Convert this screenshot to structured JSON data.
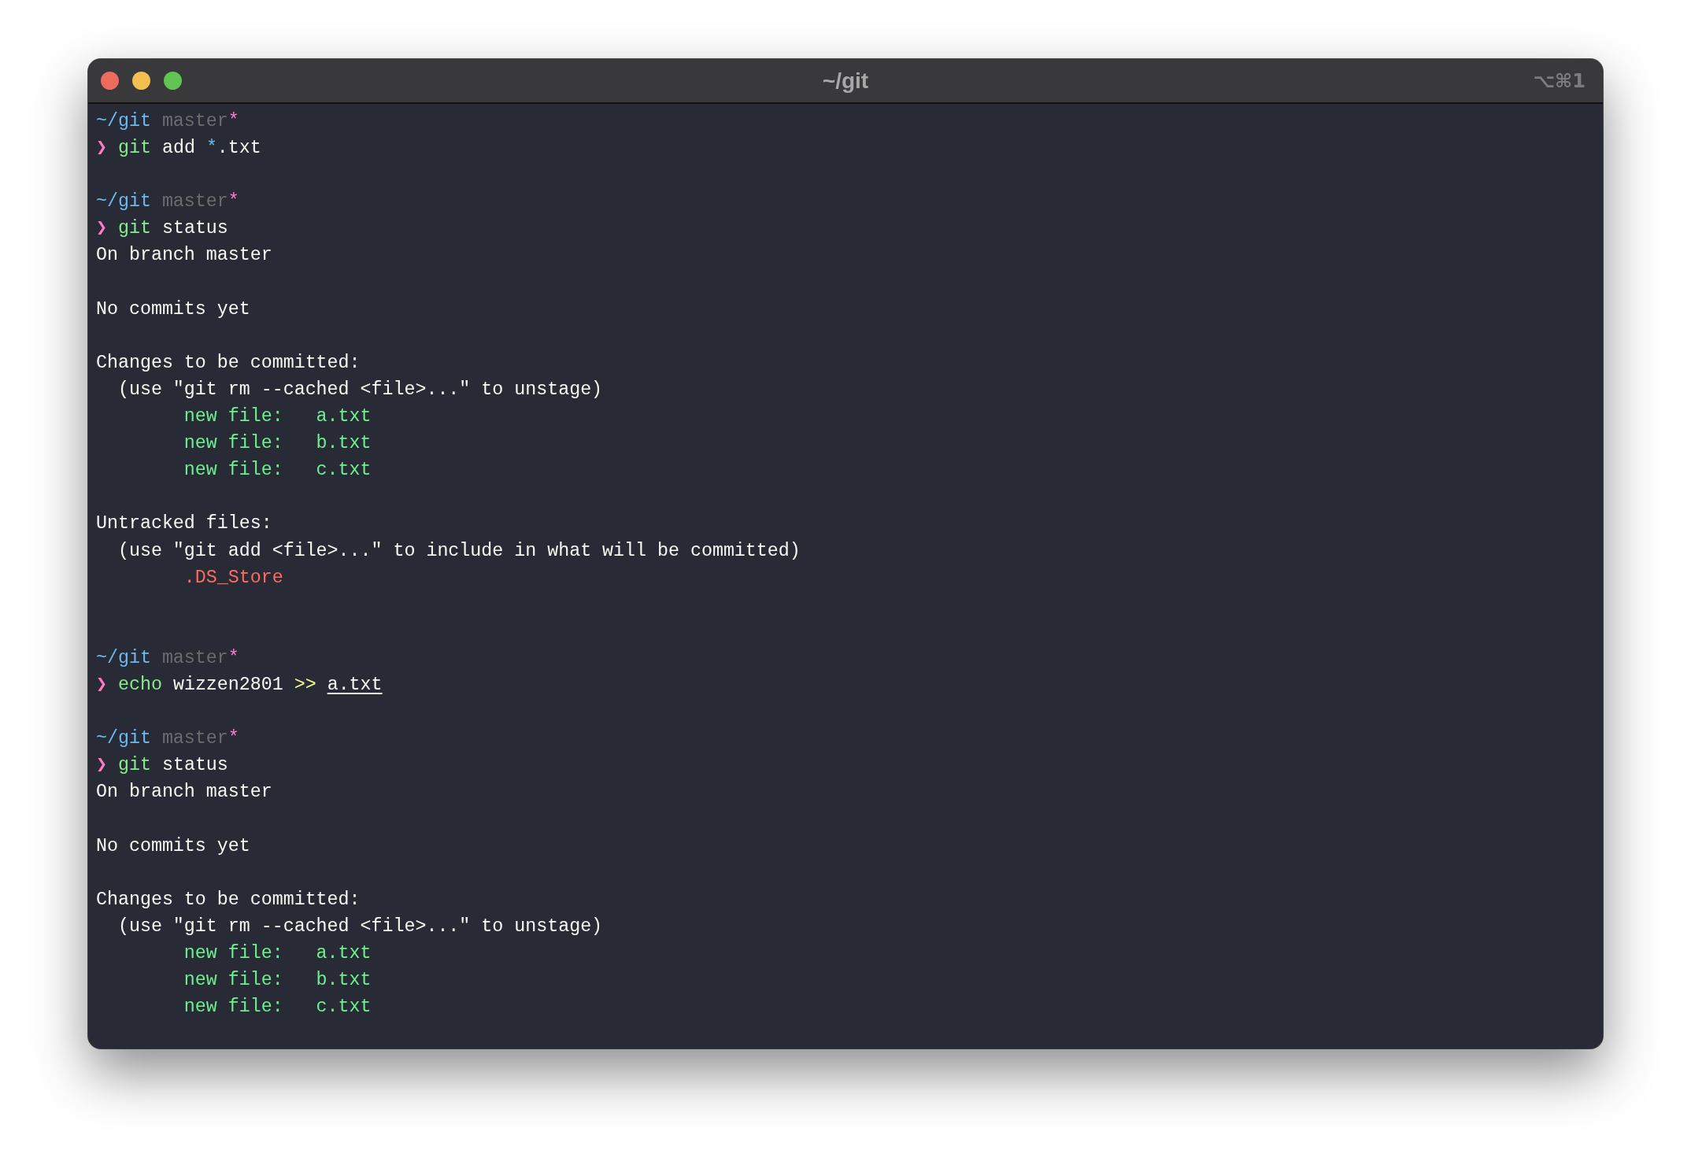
{
  "window": {
    "title": "~/git",
    "shortcut": "⌥⌘1",
    "buttons": [
      {
        "kind": "close"
      },
      {
        "kind": "minimize"
      },
      {
        "kind": "zoom"
      }
    ]
  },
  "lines": [
    {
      "kind": "text",
      "segments": [
        {
          "kind": "path",
          "text": "~/git"
        },
        {
          "kind": "branch",
          "text": " master"
        },
        {
          "kind": "dirty",
          "text": "*"
        }
      ]
    },
    {
      "kind": "text",
      "segments": [
        {
          "kind": "prompt",
          "text": "❯ "
        },
        {
          "kind": "command",
          "text": "git"
        },
        {
          "kind": "plain",
          "text": " add "
        },
        {
          "kind": "glob",
          "text": "*"
        },
        {
          "kind": "plain",
          "text": ".txt"
        }
      ]
    },
    {
      "kind": "blank"
    },
    {
      "kind": "text",
      "segments": [
        {
          "kind": "path",
          "text": "~/git"
        },
        {
          "kind": "branch",
          "text": " master"
        },
        {
          "kind": "dirty",
          "text": "*"
        }
      ]
    },
    {
      "kind": "text",
      "segments": [
        {
          "kind": "prompt",
          "text": "❯ "
        },
        {
          "kind": "command",
          "text": "git"
        },
        {
          "kind": "plain",
          "text": " status"
        }
      ]
    },
    {
      "kind": "text",
      "segments": [
        {
          "kind": "plain",
          "text": "On branch master"
        }
      ]
    },
    {
      "kind": "blank"
    },
    {
      "kind": "text",
      "segments": [
        {
          "kind": "plain",
          "text": "No commits yet"
        }
      ]
    },
    {
      "kind": "blank"
    },
    {
      "kind": "text",
      "segments": [
        {
          "kind": "plain",
          "text": "Changes to be committed:"
        }
      ]
    },
    {
      "kind": "text",
      "segments": [
        {
          "kind": "plain",
          "text": "  (use \"git rm --cached <file>...\" to unstage)"
        }
      ]
    },
    {
      "kind": "indented",
      "segments": [
        {
          "kind": "staged",
          "text": "new file:   a.txt"
        }
      ]
    },
    {
      "kind": "indented",
      "segments": [
        {
          "kind": "staged",
          "text": "new file:   b.txt"
        }
      ]
    },
    {
      "kind": "indented",
      "segments": [
        {
          "kind": "staged",
          "text": "new file:   c.txt"
        }
      ]
    },
    {
      "kind": "blank"
    },
    {
      "kind": "text",
      "segments": [
        {
          "kind": "plain",
          "text": "Untracked files:"
        }
      ]
    },
    {
      "kind": "text",
      "segments": [
        {
          "kind": "plain",
          "text": "  (use \"git add <file>...\" to include in what will be committed)"
        }
      ]
    },
    {
      "kind": "indented",
      "segments": [
        {
          "kind": "untracked",
          "text": ".DS_Store"
        }
      ]
    },
    {
      "kind": "blank"
    },
    {
      "kind": "blank"
    },
    {
      "kind": "text",
      "segments": [
        {
          "kind": "path",
          "text": "~/git"
        },
        {
          "kind": "branch",
          "text": " master"
        },
        {
          "kind": "dirty",
          "text": "*"
        }
      ]
    },
    {
      "kind": "text",
      "segments": [
        {
          "kind": "prompt",
          "text": "❯ "
        },
        {
          "kind": "command",
          "text": "echo"
        },
        {
          "kind": "plain",
          "text": " wizzen2801 "
        },
        {
          "kind": "operator",
          "text": ">> "
        },
        {
          "kind": "file",
          "text": "a.txt"
        }
      ]
    },
    {
      "kind": "blank"
    },
    {
      "kind": "text",
      "segments": [
        {
          "kind": "path",
          "text": "~/git"
        },
        {
          "kind": "branch",
          "text": " master"
        },
        {
          "kind": "dirty",
          "text": "*"
        }
      ]
    },
    {
      "kind": "text",
      "segments": [
        {
          "kind": "prompt",
          "text": "❯ "
        },
        {
          "kind": "command",
          "text": "git"
        },
        {
          "kind": "plain",
          "text": " status"
        }
      ]
    },
    {
      "kind": "text",
      "segments": [
        {
          "kind": "plain",
          "text": "On branch master"
        }
      ]
    },
    {
      "kind": "blank"
    },
    {
      "kind": "text",
      "segments": [
        {
          "kind": "plain",
          "text": "No commits yet"
        }
      ]
    },
    {
      "kind": "blank"
    },
    {
      "kind": "text",
      "segments": [
        {
          "kind": "plain",
          "text": "Changes to be committed:"
        }
      ]
    },
    {
      "kind": "text",
      "segments": [
        {
          "kind": "plain",
          "text": "  (use \"git rm --cached <file>...\" to unstage)"
        }
      ]
    },
    {
      "kind": "indented",
      "segments": [
        {
          "kind": "staged",
          "text": "new file:   a.txt"
        }
      ]
    },
    {
      "kind": "indented",
      "segments": [
        {
          "kind": "staged",
          "text": "new file:   b.txt"
        }
      ]
    },
    {
      "kind": "indented",
      "segments": [
        {
          "kind": "staged",
          "text": "new file:   c.txt"
        }
      ]
    }
  ]
}
